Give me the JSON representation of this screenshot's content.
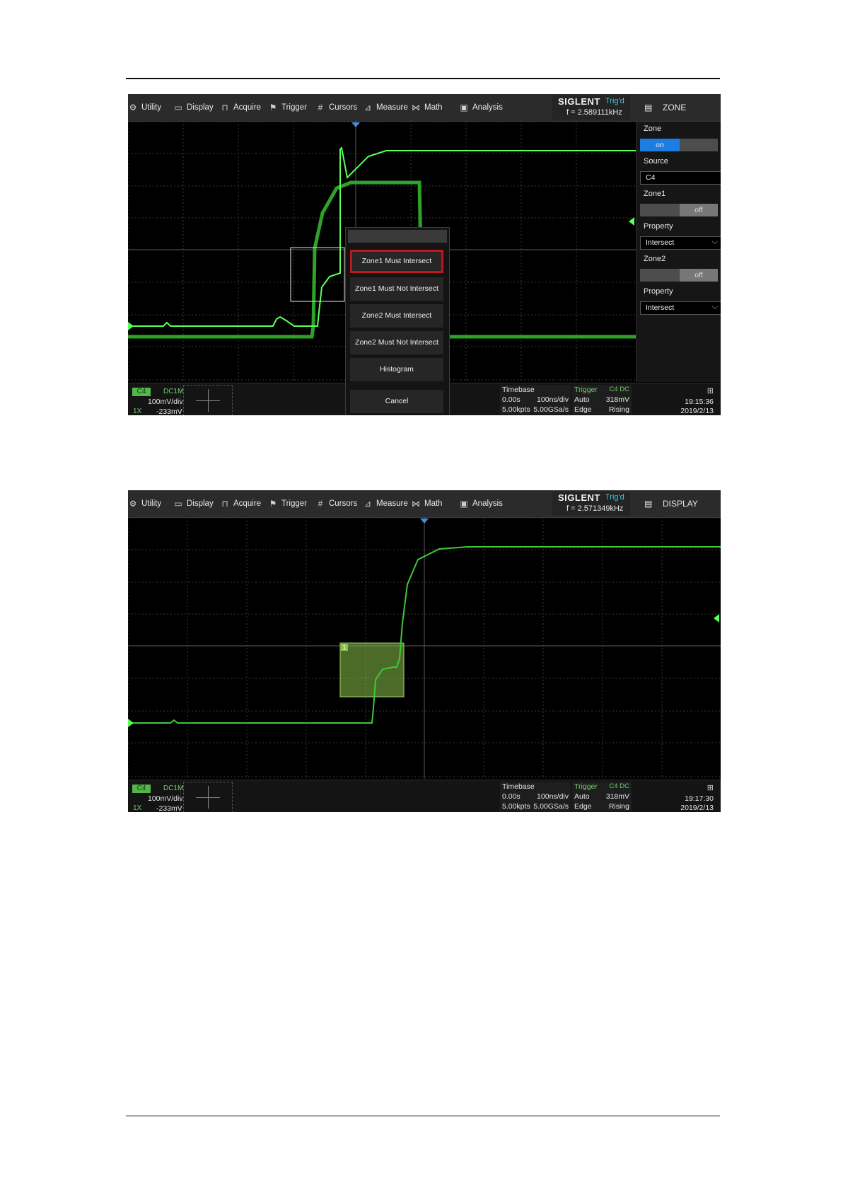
{
  "menu": {
    "utility": "Utility",
    "display": "Display",
    "acquire": "Acquire",
    "trigger": "Trigger",
    "cursors": "Cursors",
    "measure": "Measure",
    "math": "Math",
    "analysis": "Analysis",
    "brand": "SIGLENT",
    "trig_state": "Trig'd"
  },
  "screen1": {
    "frequency": "f = 2.589111kHz",
    "menu_title": "ZONE",
    "side": {
      "zone_label": "Zone",
      "zone_on": "on",
      "source_label": "Source",
      "source_value": "C4",
      "zone1_label": "Zone1",
      "zone1_state": "off",
      "property1_label": "Property",
      "property1_value": "Intersect",
      "zone2_label": "Zone2",
      "zone2_state": "off",
      "property2_label": "Property",
      "property2_value": "Intersect"
    },
    "popup": {
      "items": [
        "Zone1 Must Intersect",
        "Zone1 Must Not Intersect",
        "Zone2 Must Intersect",
        "Zone2 Must Not Intersect",
        "Histogram"
      ],
      "selected": "Zone1 Must Intersect",
      "cancel": "Cancel"
    },
    "time": "19:15:36",
    "date": "2019/2/13"
  },
  "screen2": {
    "frequency": "f = 2.571349kHz",
    "menu_title": "DISPLAY",
    "zone_number": "1",
    "time": "19:17:30",
    "date": "2019/2/13"
  },
  "status": {
    "channel": "C4",
    "coupling": "DC1M",
    "vdiv": "100mV/div",
    "probe": "1X",
    "offset": "-233mV",
    "timebase_label": "Timebase",
    "delay": "0.00s",
    "tdiv": "100ns/div",
    "memory": "5.00kpts",
    "srate": "5.00GSa/s",
    "trigger_label": "Trigger",
    "trigger_source": "C4 DC",
    "trigger_mode": "Auto",
    "trigger_level": "318mV",
    "trigger_type": "Edge",
    "trigger_slope": "Rising"
  },
  "colors": {
    "trace": "#39c43a",
    "trace_bright": "#5dff5a",
    "zone_fill": "#8bc34a",
    "selection_border": "#c0151a",
    "grid": "#3a3a3a",
    "toggle_on": "#1e7de0"
  },
  "icons": [
    "gear-icon",
    "monitor-icon",
    "acquire-icon",
    "flag-icon",
    "hash-icon",
    "measure-icon",
    "math-icon",
    "analysis-icon",
    "document-icon",
    "network-icon",
    "trigger-marker-icon",
    "ground-marker-icon",
    "level-marker-icon"
  ]
}
